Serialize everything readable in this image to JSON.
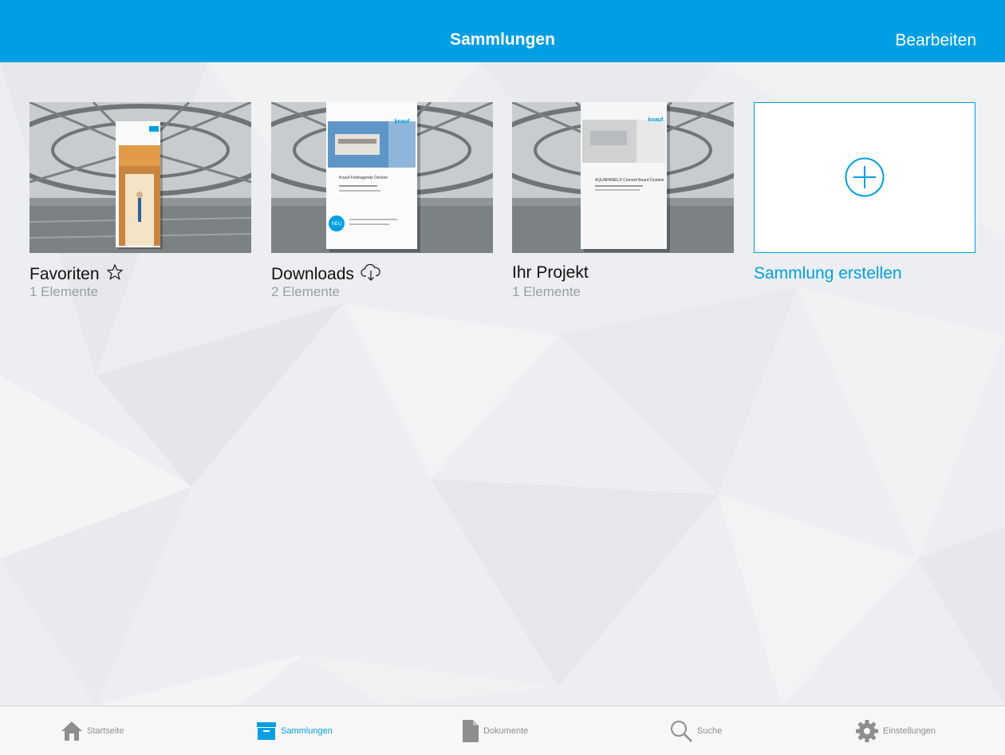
{
  "navbar": {
    "title": "Sammlungen",
    "edit_label": "Bearbeiten"
  },
  "collections": [
    {
      "title": "Favoriten",
      "count": "1 Elemente",
      "icon": "star-icon"
    },
    {
      "title": "Downloads",
      "count": "2 Elemente",
      "icon": "cloud-download-icon"
    },
    {
      "title": "Ihr Projekt",
      "count": "1 Elemente"
    }
  ],
  "create": {
    "label": "Sammlung erstellen",
    "icon": "plus-circle-icon"
  },
  "tabbar": {
    "items": [
      {
        "label": "Startseite",
        "icon": "home-icon"
      },
      {
        "label": "Sammlungen",
        "icon": "box-icon",
        "active": true
      },
      {
        "label": "Dokumente",
        "icon": "document-icon"
      },
      {
        "label": "Suche",
        "icon": "search-icon"
      },
      {
        "label": "Einstellungen",
        "icon": "gear-icon"
      }
    ]
  },
  "brochures": {
    "brand": "knauf",
    "downloads_heading": "Knauf Freitragende Decken",
    "downloads_badge": "NEU",
    "project_heading": "AQUAPANEL® Cement Board Outdoor"
  },
  "colors": {
    "accent": "#009fe3",
    "tabbar_bg": "#f7f7f7",
    "muted": "#9a9ea3"
  }
}
